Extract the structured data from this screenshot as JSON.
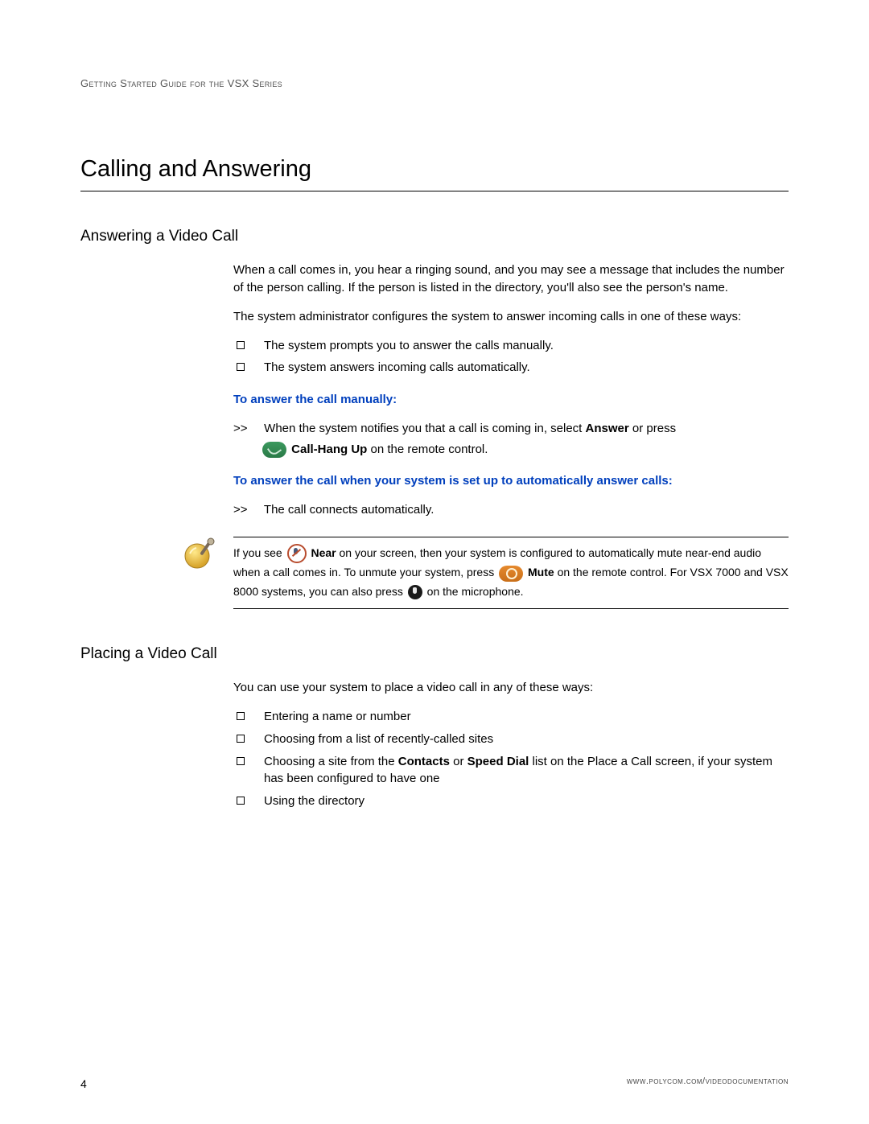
{
  "header": {
    "running": "Getting Started Guide for the VSX Series"
  },
  "chapter": {
    "title": "Calling and Answering"
  },
  "section1": {
    "title": "Answering a Video Call",
    "p1": "When a call comes in, you hear a ringing sound, and you may see a message that includes the number of the person calling. If the person is listed in the directory, you'll also see the person's name.",
    "p2": "The system administrator configures the system to answer incoming calls in one of these ways:",
    "bullets": [
      "The system prompts you to answer the calls manually.",
      "The system answers incoming calls automatically."
    ],
    "head1": "To answer the call manually:",
    "step1_prefix": ">>",
    "step1_a": "When the system notifies you that a call is coming in, select ",
    "step1_answer": "Answer",
    "step1_b": " or press ",
    "step1_callhang": "Call-Hang Up",
    "step1_c": " on the remote control.",
    "head2": "To answer the call when your system is set up to automatically answer calls:",
    "step2_prefix": ">>",
    "step2": "The call connects automatically.",
    "note": {
      "a": "If you see ",
      "near": "Near",
      "b": " on your screen, then your system is configured to automatically mute near-end audio when a call comes in. To unmute your system, press ",
      "mute": "Mute",
      "c": " on the remote control. For VSX 7000 and VSX 8000 systems, you can also press ",
      "d": " on the microphone."
    }
  },
  "section2": {
    "title": "Placing a Video Call",
    "p1": "You can use your system to place a video call in any of these ways:",
    "b1": "Entering a name or number",
    "b2": "Choosing from a list of recently-called sites",
    "b3a": "Choosing a site from the ",
    "b3_contacts": "Contacts",
    "b3b": " or ",
    "b3_speed": "Speed Dial",
    "b3c": " list on the Place a Call screen, if your system has been configured to have one",
    "b4": "Using the directory"
  },
  "footer": {
    "page": "4",
    "url": "www.polycom.com/videodocumentation"
  },
  "icons": {
    "call": "call-icon",
    "near": "near-mute-icon",
    "mute_button": "mute-button-icon",
    "mic": "microphone-icon",
    "note": "note-bell-icon"
  }
}
